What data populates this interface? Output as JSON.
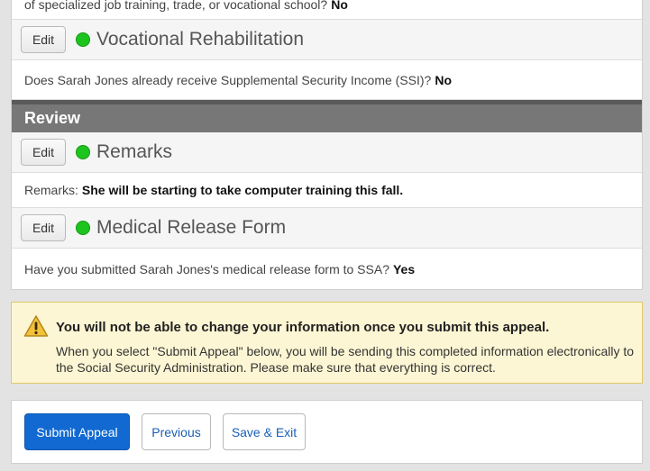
{
  "summary": {
    "partial_line": {
      "question": "of specialized job training, trade, or vocational school?",
      "answer": "No"
    },
    "sections": [
      {
        "edit_label": "Edit",
        "title": "Vocational Rehabilitation",
        "question": "Does Sarah Jones already receive Supplemental Security Income (SSI)?",
        "answer": "No"
      }
    ],
    "review_heading": "Review",
    "review_sections": [
      {
        "edit_label": "Edit",
        "title": "Remarks",
        "question": "Remarks:",
        "answer": "She will be starting to take computer training this fall."
      },
      {
        "edit_label": "Edit",
        "title": "Medical Release Form",
        "question": "Have you submitted Sarah Jones's medical release form to SSA?",
        "answer": "Yes"
      }
    ],
    "status_color": "#1ec41e"
  },
  "warning": {
    "icon": "warning-triangle-icon",
    "title": "You will not be able to change your information once you submit this appeal.",
    "text": "When you select \"Submit Appeal\" below, you will be sending this completed information electronically to the Social Security Administration. Please make sure that everything is correct."
  },
  "actions": {
    "submit_label": "Submit Appeal",
    "previous_label": "Previous",
    "save_exit_label": "Save & Exit",
    "primary_color": "#1169d1"
  }
}
